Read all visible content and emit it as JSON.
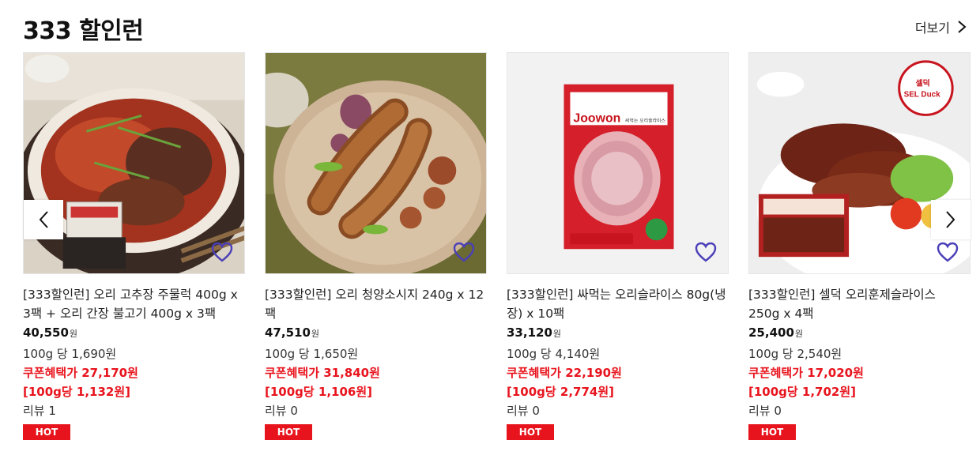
{
  "section": {
    "title": "333 할인런",
    "more_label": "더보기"
  },
  "colors": {
    "accent_red": "#e8141d",
    "heart": "#4a3fb8"
  },
  "products": [
    {
      "name": "[333할인런] 오리 고추장 주물럭 400g x 3팩 + 오리 간장 불고기 400g x 3팩",
      "price": "40,550",
      "won": "원",
      "unit_price": "100g 당 1,690원",
      "coupon_price": "쿠폰혜택가 27,170원",
      "coupon_unit": "[100g당 1,132원]",
      "review": "리뷰 1",
      "badge": "HOT",
      "image_icon": "duck-stirfry-photo"
    },
    {
      "name": "[333할인런] 오리 청양소시지 240g x 12팩",
      "price": "47,510",
      "won": "원",
      "unit_price": "100g 당 1,650원",
      "coupon_price": "쿠폰혜택가 31,840원",
      "coupon_unit": "[100g당 1,106원]",
      "review": "리뷰 0",
      "badge": "HOT",
      "image_icon": "sausage-photo"
    },
    {
      "name": "[333할인런] 싸먹는 오리슬라이스 80g(냉장) x 10팩",
      "price": "33,120",
      "won": "원",
      "unit_price": "100g 당 4,140원",
      "coupon_price": "쿠폰혜택가 22,190원",
      "coupon_unit": "[100g당 2,774원]",
      "review": "리뷰 0",
      "badge": "HOT",
      "image_icon": "duck-slice-package-photo",
      "package_brand": "Joowon",
      "package_label": "싸먹는 오리슬라이스"
    },
    {
      "name": "[333할인런] 셀덕 오리훈제슬라이스 250g x 4팩",
      "price": "25,400",
      "won": "원",
      "unit_price": "100g 당 2,540원",
      "coupon_price": "쿠폰혜택가 17,020원",
      "coupon_unit": "[100g당 1,702원]",
      "review": "리뷰 0",
      "badge": "HOT",
      "image_icon": "smoked-duck-photo",
      "logo_text": "셀덕",
      "logo_sub": "SEL Duck"
    }
  ]
}
